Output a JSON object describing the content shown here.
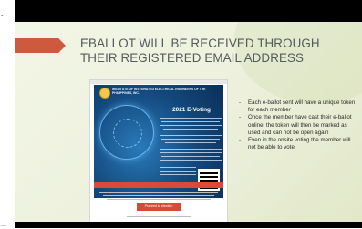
{
  "slide": {
    "title_line1": "EBALLOT WILL BE RECEIVED THROUGH",
    "title_line2": "THEIR REGISTERED EMAIL ADDRESS",
    "bullets": [
      "Each e-ballot sent will have a unique token for each member",
      "Once the member have cast their e-ballot online, the token will then be marked as used and can not be open again",
      "Even in the onsite voting the member will not be able to vote"
    ],
    "bullet_marker": "-"
  },
  "email": {
    "org_name": "INSTITUTE OF INTEGRATED ELECTRICAL ENGINEERS OF THE PHILIPPINES, INC.",
    "hero_title": "2021 E-Voting",
    "proceed_button": "Proceed to election"
  },
  "colors": {
    "accent_arrow": "#cd5a3c",
    "title_text": "#555a5c",
    "hero_blue": "#13487c",
    "button_red": "#d94a38"
  }
}
